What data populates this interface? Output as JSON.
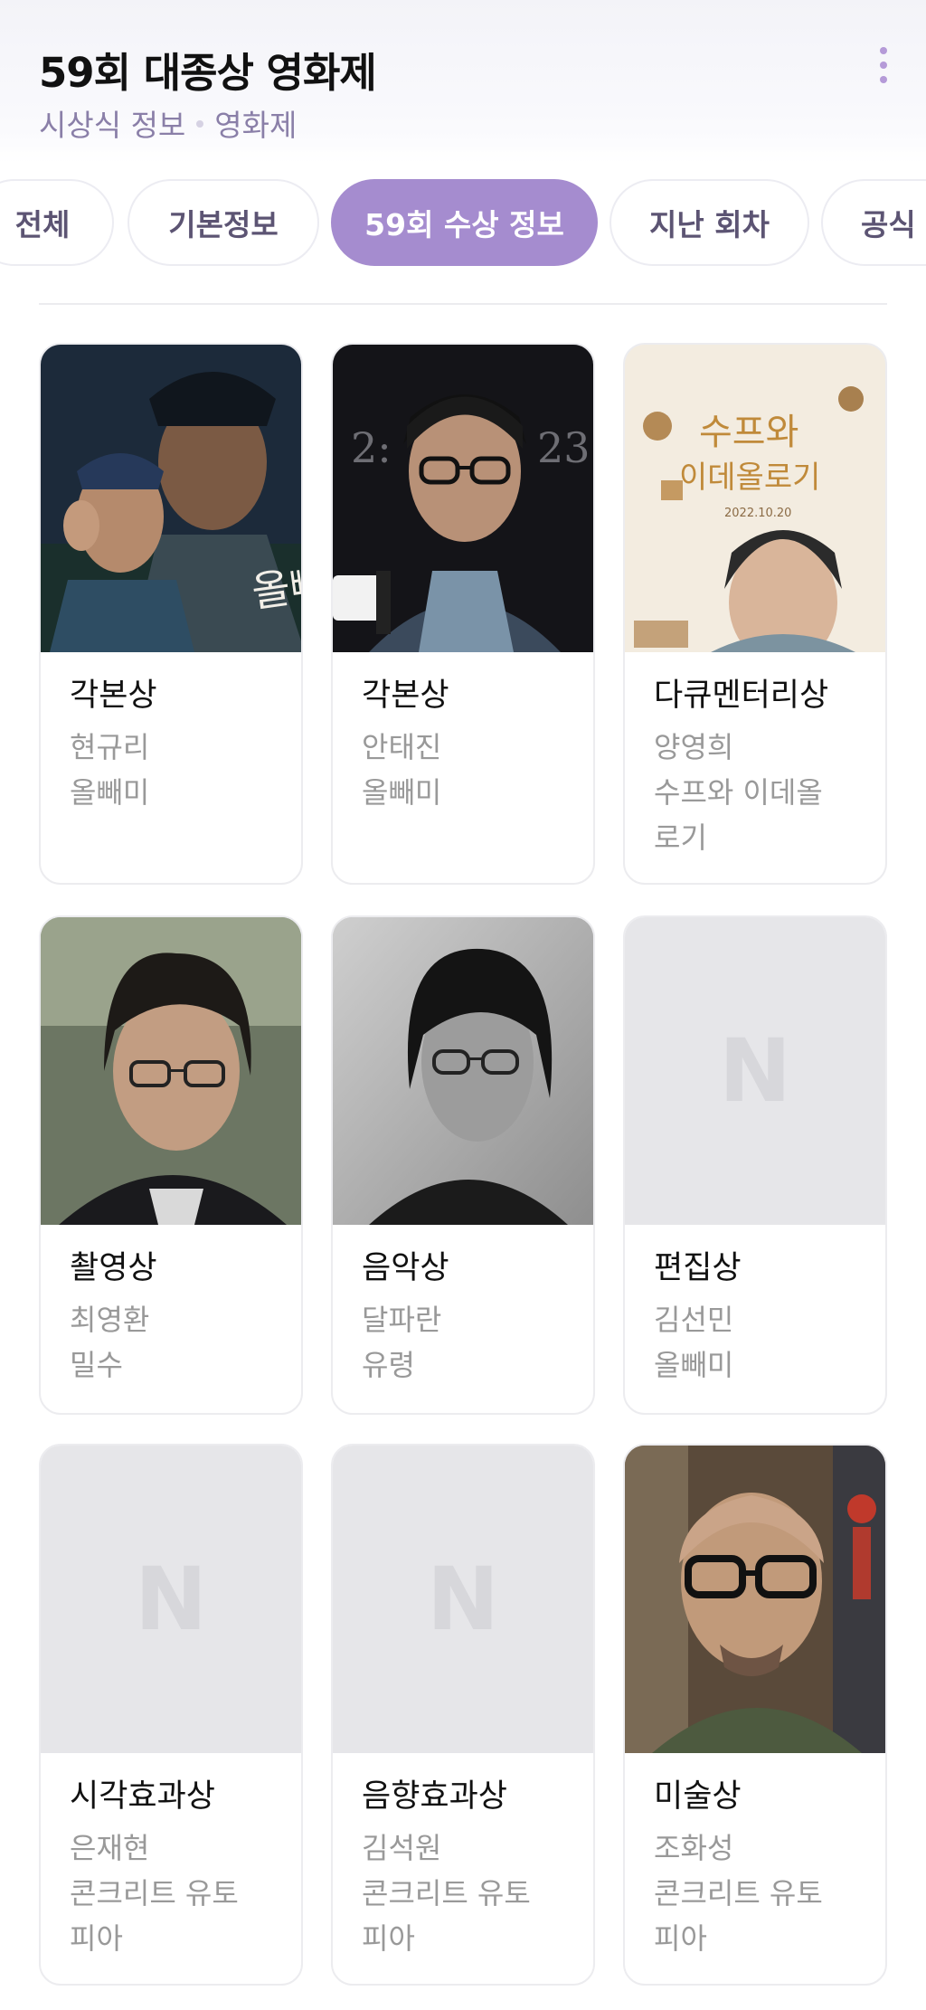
{
  "header": {
    "title": "59회 대종상 영화제",
    "subtitle_parts": [
      "시상식 정보",
      "영화제"
    ]
  },
  "tabs": [
    {
      "label": "전체",
      "active": false
    },
    {
      "label": "기본정보",
      "active": false
    },
    {
      "label": "59회 수상 정보",
      "active": true
    },
    {
      "label": "지난 회차",
      "active": false
    },
    {
      "label": "공식",
      "active": false
    }
  ],
  "awards": [
    {
      "award": "각본상",
      "winner": "현규리",
      "work": "올빼미",
      "image": "photo"
    },
    {
      "award": "각본상",
      "winner": "안태진",
      "work": "올빼미",
      "image": "photo"
    },
    {
      "award": "다큐멘터리상",
      "winner": "양영희",
      "work": [
        "수프와 이데올",
        "로기"
      ],
      "image": "poster"
    },
    {
      "award": "촬영상",
      "winner": "최영환",
      "work": "밀수",
      "image": "photo"
    },
    {
      "award": "음악상",
      "winner": "달파란",
      "work": "유령",
      "image": "photo"
    },
    {
      "award": "편집상",
      "winner": "김선민",
      "work": "올빼미",
      "image": "placeholder"
    },
    {
      "award": "시각효과상",
      "winner": "은재현",
      "work": [
        "콘크리트 유토",
        "피아"
      ],
      "image": "placeholder"
    },
    {
      "award": "음향효과상",
      "winner": "김석원",
      "work": [
        "콘크리트 유토",
        "피아"
      ],
      "image": "placeholder"
    },
    {
      "award": "미술상",
      "winner": "조화성",
      "work": [
        "콘크리트 유토",
        "피아"
      ],
      "image": "photo"
    }
  ],
  "poster_texts": {
    "owl_title": "올빼미",
    "soup_title_1": "수프와",
    "soup_title_2": "이데올로기",
    "soup_date": "2022.10.20",
    "backdrop_left": "2:",
    "backdrop_right": "23"
  },
  "placeholder_logo": "N",
  "colors": {
    "accent": "#a58ccf",
    "subtitle": "#8a7fa8",
    "muted_text": "#999999",
    "placeholder_bg": "#e6e6e9"
  }
}
